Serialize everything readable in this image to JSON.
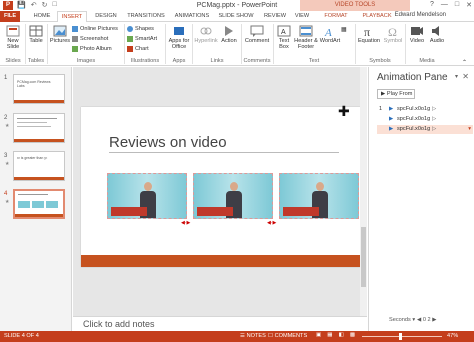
{
  "window": {
    "title": "PCMag.pptx - PowerPoint",
    "context_tab": "VIDEO TOOLS",
    "user": "Edward Mendelson",
    "qat_icons": [
      "save-icon",
      "undo-icon",
      "redo-icon",
      "slideshow-icon"
    ],
    "controls": [
      "?",
      "—",
      "□",
      "✕"
    ]
  },
  "tabs": [
    "FILE",
    "HOME",
    "INSERT",
    "DESIGN",
    "TRANSITIONS",
    "ANIMATIONS",
    "SLIDE SHOW",
    "REVIEW",
    "VIEW",
    "FORMAT",
    "PLAYBACK"
  ],
  "active_tab": "INSERT",
  "ribbon": {
    "new_slide": "New Slide",
    "table": "Table",
    "pictures": "Pictures",
    "online_pictures": "Online Pictures",
    "screenshot": "Screenshot",
    "photo_album": "Photo Album",
    "shapes": "Shapes",
    "smartart": "SmartArt",
    "chart": "Chart",
    "apps_for_office": "Apps for Office",
    "hyperlink": "Hyperlink",
    "action": "Action",
    "comment": "Comment",
    "text_box": "Text Box",
    "header_footer": "Header & Footer",
    "wordart": "WordArt",
    "equation": "Equation",
    "symbol": "Symbol",
    "video": "Video",
    "audio": "Audio",
    "groups": {
      "slides": "Slides",
      "tables": "Tables",
      "images": "Images",
      "illustrations": "Illustrations",
      "apps": "Apps",
      "links": "Links",
      "comments": "Comments",
      "text": "Text",
      "symbols": "Symbols",
      "media": "Media"
    }
  },
  "thumbnails": [
    {
      "num": "1",
      "text": "PCMag.com Reviews Labs"
    },
    {
      "num": "2",
      "text": ""
    },
    {
      "num": "3",
      "text": "x² is greater than y²"
    },
    {
      "num": "4",
      "text": ""
    }
  ],
  "slide": {
    "title": "Reviews on video"
  },
  "notes_placeholder": "Click to add notes",
  "animation_pane": {
    "title": "Animation Pane",
    "play_from": "Play From",
    "items": [
      {
        "num": "1",
        "label": "spcFul.x0o1g"
      },
      {
        "num": "",
        "label": "spcFul.x0o1g"
      },
      {
        "num": "",
        "label": "spcFul.x0o1g"
      }
    ],
    "seconds_label": "Seconds",
    "ruler": "0      2"
  },
  "status": {
    "slide_info": "SLIDE 4 OF 4",
    "notes": "NOTES",
    "comments": "COMMENTS",
    "zoom": "47%"
  },
  "colors": {
    "accent": "#c43e1c",
    "slide_footer": "#c6521f"
  }
}
